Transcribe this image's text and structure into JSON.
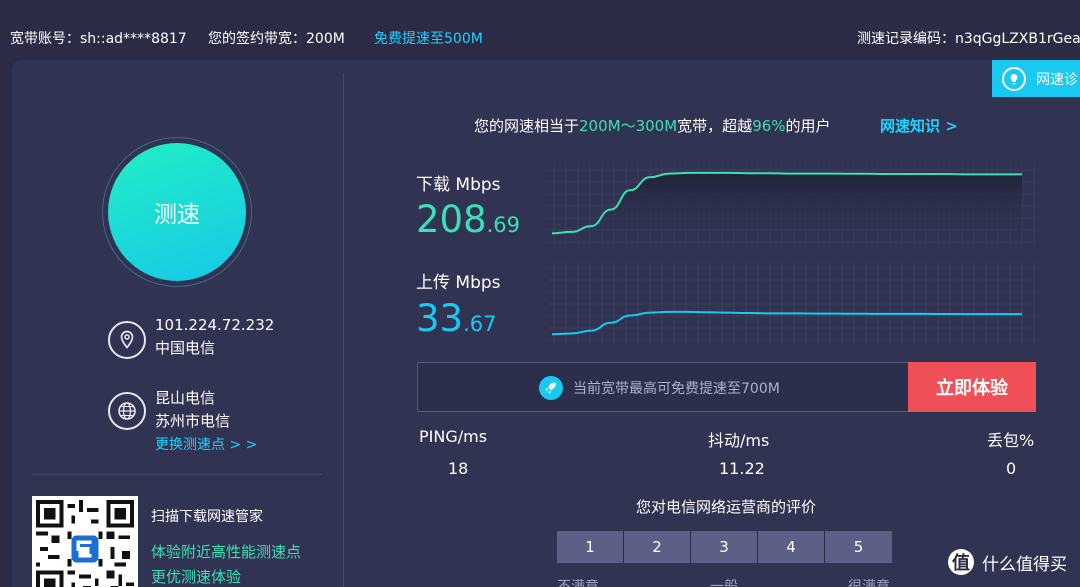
{
  "topbar": {
    "account": "宽带账号：sh::ad****8817",
    "plan": "您的签约带宽：200M",
    "upgrade_link": "免费提速至500M",
    "record": "测速记录编码：n3qGgLZXB1rGea"
  },
  "side_tab": {
    "label": "网速诊",
    "icon": "bulb-icon"
  },
  "test_button": {
    "label": "测速"
  },
  "location": {
    "ip": "101.224.72.232",
    "isp": "中国电信",
    "node_line1": "昆山电信",
    "node_line2": "苏州市电信",
    "change_node": "更换测速点 > >"
  },
  "promo": {
    "scan": "扫描下载网速管家",
    "line1": "体验附近高性能测速点",
    "line2": "更优测速体验"
  },
  "summary": {
    "prefix": "您的网速相当于",
    "range": "200M～300M",
    "mid": "宽带，超越",
    "percent": "96%",
    "suffix": "的用户",
    "knowledge_link": "网速知识 >"
  },
  "download": {
    "label": "下载 Mbps",
    "int": "208",
    "dec": ".69"
  },
  "upload": {
    "label": "上传 Mbps",
    "int": "33",
    "dec": ".67"
  },
  "chart_data": [
    {
      "type": "area",
      "name": "download-graph",
      "values": [
        0.12,
        0.14,
        0.22,
        0.45,
        0.72,
        0.9,
        0.95,
        0.96,
        0.96,
        0.96,
        0.955,
        0.955,
        0.95,
        0.95,
        0.95,
        0.948,
        0.948,
        0.945,
        0.945,
        0.945,
        0.945,
        0.94,
        0.94,
        0.94,
        0.94
      ],
      "color": "#3ddfb5"
    },
    {
      "type": "line",
      "name": "upload-graph",
      "values": [
        0.08,
        0.09,
        0.13,
        0.24,
        0.34,
        0.38,
        0.39,
        0.39,
        0.385,
        0.38,
        0.375,
        0.37,
        0.37,
        0.368,
        0.366,
        0.365,
        0.364,
        0.363,
        0.362,
        0.362,
        0.361,
        0.36,
        0.36,
        0.36,
        0.36
      ],
      "color": "#19c9f2"
    }
  ],
  "boost": {
    "text": "当前宽带最高可免费提速至700M",
    "button": "立即体验"
  },
  "stats": {
    "ping_label": "PING/ms",
    "ping_value": "18",
    "jitter_label": "抖动/ms",
    "jitter_value": "11.22",
    "loss_label": "丢包%",
    "loss_value": "0"
  },
  "rating": {
    "title": "您对电信网络运营商的评价",
    "options": [
      "1",
      "2",
      "3",
      "4",
      "5"
    ],
    "scale": [
      "不满意",
      "一般",
      "很满意"
    ]
  },
  "watermark": {
    "logo": "值",
    "text": "什么值得买"
  }
}
